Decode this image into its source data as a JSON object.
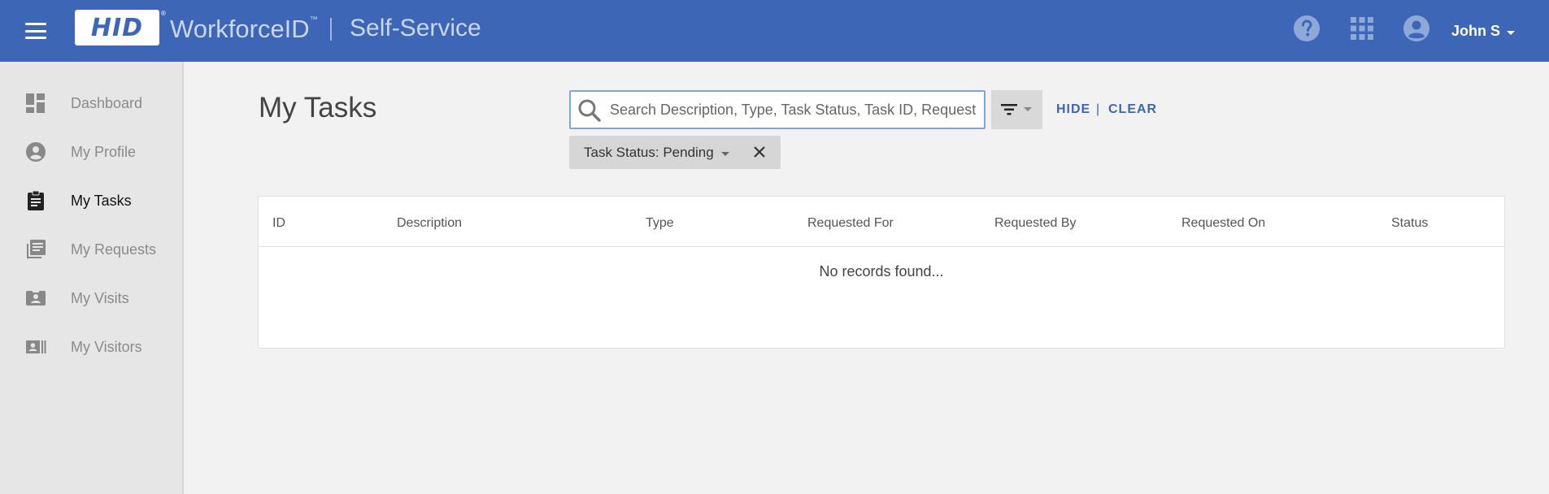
{
  "header": {
    "logo": "HID",
    "logo_reg": "®",
    "brand": "WorkforceID",
    "brand_tm": "™",
    "product": "Self-Service",
    "user_name": "John S"
  },
  "sidebar": {
    "items": [
      {
        "label": "Dashboard",
        "icon": "dashboard-icon",
        "active": false
      },
      {
        "label": "My Profile",
        "icon": "account-circle-icon",
        "active": false
      },
      {
        "label": "My Tasks",
        "icon": "clipboard-icon",
        "active": true
      },
      {
        "label": "My Requests",
        "icon": "library-books-icon",
        "active": false
      },
      {
        "label": "My Visits",
        "icon": "badge-icon",
        "active": false
      },
      {
        "label": "My Visitors",
        "icon": "contacts-icon",
        "active": false
      }
    ]
  },
  "main": {
    "title": "My Tasks",
    "search": {
      "placeholder": "Search Description, Type, Task Status, Task ID, Request I",
      "value": ""
    },
    "hide_label": "HIDE",
    "separator": "|",
    "clear_label": "CLEAR",
    "filter_chip": {
      "label": "Task Status: Pending"
    },
    "table": {
      "columns": [
        "ID",
        "Description",
        "Type",
        "Requested For",
        "Requested By",
        "Requested On",
        "Status"
      ],
      "empty_message": "No records found..."
    }
  },
  "colors": {
    "header_bg": "#3d67b6",
    "accent": "#3d67b6",
    "sidebar_bg": "#e6e6e6",
    "page_bg": "#f2f2f2"
  }
}
